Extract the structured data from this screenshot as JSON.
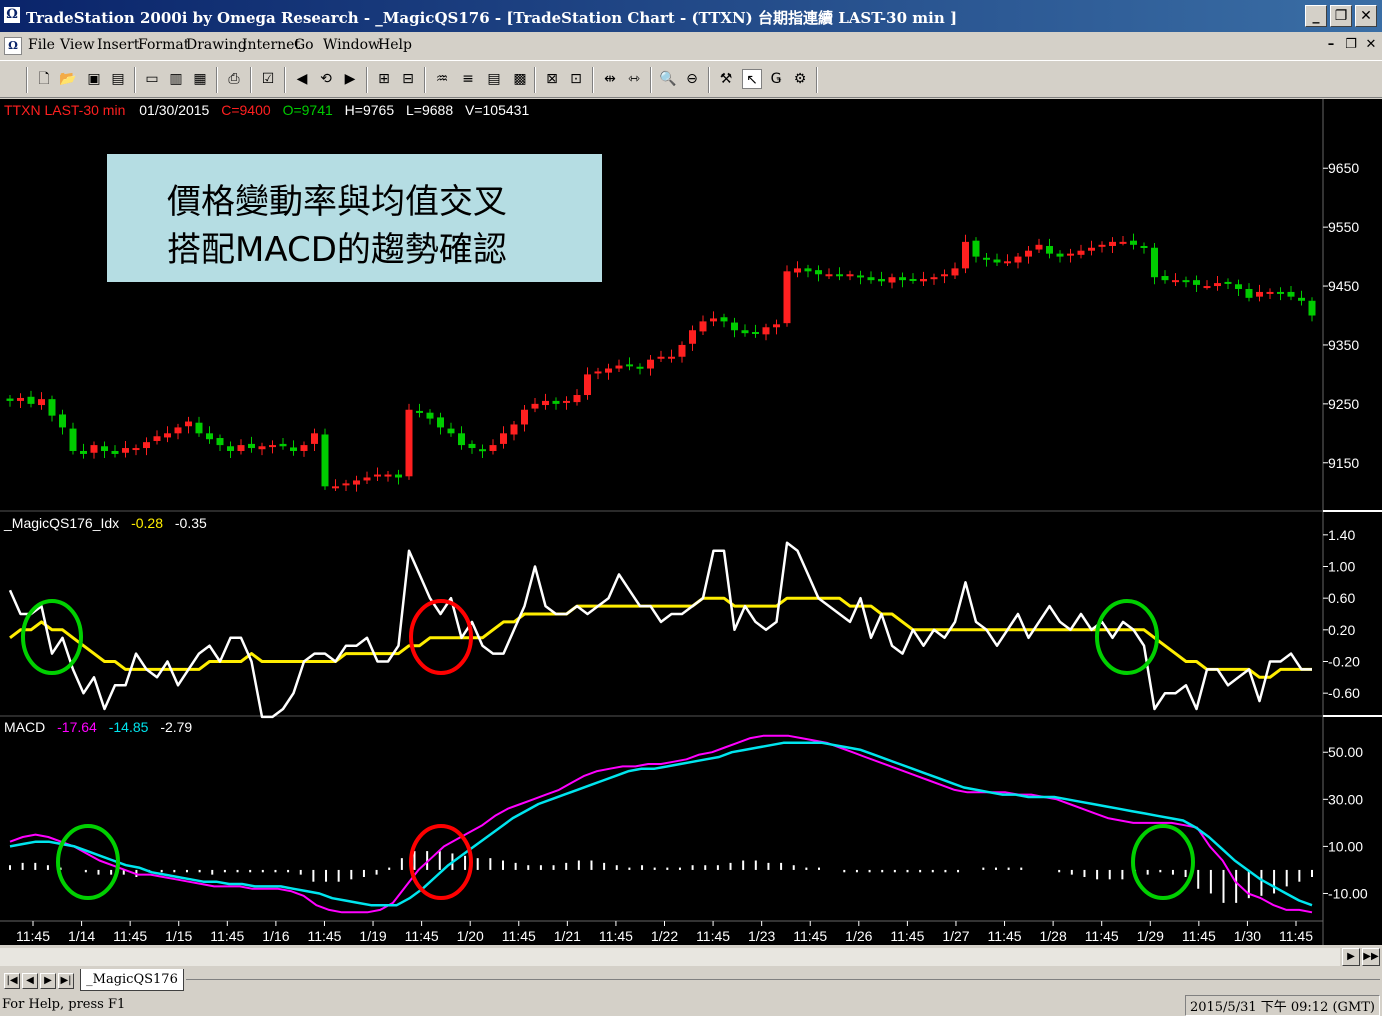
{
  "window": {
    "title": "TradeStation 2000i by Omega Research - _MagicQS176 - [TradeStation Chart - (TTXN) 台期指連續 LAST-30 min ]",
    "app_icon": "omega-icon"
  },
  "menu": {
    "items": [
      "File",
      "View",
      "Insert",
      "Format",
      "Drawing",
      "Internet",
      "Go",
      "Window",
      "Help"
    ]
  },
  "toolbar": {
    "icons": [
      "new-icon",
      "open-icon",
      "save-all-icon",
      "open-folder-icon",
      "window-icon",
      "chart-icon",
      "grid-icon",
      "print-icon",
      "properties-icon",
      "back-icon",
      "refresh-icon",
      "forward-icon",
      "insert-indicator-icon",
      "insert-study-icon",
      "analysis-icon",
      "format-icon",
      "table-icon",
      "activity-icon",
      "tile-icon",
      "space-in-icon",
      "space-out-icon",
      "zoom-in-icon",
      "zoom-out-icon",
      "hammer-icon",
      "pointer-icon",
      "gap-icon",
      "magnet-icon"
    ]
  },
  "chart": {
    "price_header": {
      "symbol": "TTXN LAST-30 min",
      "date": "01/30/2015",
      "close": "C=9400",
      "open": "O=9741",
      "high": "H=9765",
      "low": "L=9688",
      "volume": "V=105431"
    },
    "annotation": {
      "line1": "價格變動率與均值交叉",
      "line2": "搭配MACD的趨勢確認"
    },
    "idx_header": {
      "name": "_MagicQS176_Idx",
      "value1": "-0.28",
      "value2": "-0.35"
    },
    "macd_header": {
      "name": "MACD",
      "value1": "-17.64",
      "value2": "-14.85",
      "value3": "-2.79"
    },
    "price_axis": [
      "9650",
      "9550",
      "9450",
      "9350",
      "9250",
      "9150"
    ],
    "idx_axis": [
      "1.40",
      "1.00",
      "0.60",
      "0.20",
      "-0.20",
      "-0.60"
    ],
    "macd_axis": [
      "50.00",
      "30.00",
      "10.00",
      "-10.00"
    ],
    "time_axis": [
      "11:45",
      "1/14",
      "11:45",
      "1/15",
      "11:45",
      "1/16",
      "11:45",
      "1/19",
      "11:45",
      "1/20",
      "11:45",
      "1/21",
      "11:45",
      "1/22",
      "11:45",
      "1/23",
      "11:45",
      "1/26",
      "11:45",
      "1/27",
      "11:45",
      "1/28",
      "11:45",
      "1/29",
      "11:45",
      "1/30",
      "11:45"
    ],
    "colors": {
      "up": "#ff2020",
      "down": "#00cc00",
      "idx_line": "#ffffff",
      "idx_avg": "#ffee00",
      "macd": "#ff00ff",
      "signal": "#00e5ee",
      "hist": "#ffffff",
      "circle_green": "#00d000",
      "circle_red": "#ff0000",
      "header_red": "#ff2020",
      "header_green": "#00cc00",
      "header_yellow": "#ffee00",
      "header_magenta": "#ff00ff",
      "header_cyan": "#00e5ee"
    }
  },
  "chart_data": [
    {
      "type": "candlestick",
      "title": "TTXN LAST-30 min",
      "ylim": [
        9080,
        9720
      ],
      "yticks": [
        9650,
        9550,
        9450,
        9350,
        9250,
        9150
      ],
      "close_path": [
        9255,
        9260,
        9250,
        9258,
        9230,
        9210,
        9170,
        9165,
        9180,
        9170,
        9165,
        9175,
        9175,
        9185,
        9195,
        9200,
        9210,
        9220,
        9200,
        9190,
        9180,
        9170,
        9180,
        9175,
        9178,
        9180,
        9178,
        9170,
        9180,
        9200,
        9110,
        9110,
        9115,
        9120,
        9125,
        9130,
        9130,
        9125,
        9240,
        9235,
        9225,
        9210,
        9200,
        9180,
        9175,
        9170,
        9180,
        9200,
        9215,
        9240,
        9250,
        9255,
        9250,
        9255,
        9265,
        9300,
        9305,
        9310,
        9315,
        9315,
        9310,
        9325,
        9330,
        9330,
        9350,
        9375,
        9390,
        9395,
        9390,
        9375,
        9370,
        9370,
        9380,
        9385,
        9475,
        9480,
        9475,
        9470,
        9470,
        9468,
        9470,
        9465,
        9460,
        9458,
        9465,
        9460,
        9460,
        9462,
        9465,
        9470,
        9480,
        9525,
        9500,
        9495,
        9490,
        9492,
        9500,
        9510,
        9520,
        9505,
        9500,
        9505,
        9510,
        9515,
        9520,
        9525,
        9525,
        9520,
        9515,
        9465,
        9460,
        9460,
        9458,
        9452,
        9450,
        9455,
        9455,
        9445,
        9430,
        9440,
        9440,
        9438,
        9432,
        9425,
        9400
      ],
      "data_note": "Values read from the price panel; green candles are down bars and red candles are up bars."
    },
    {
      "type": "line",
      "title": "_MagicQS176_Idx",
      "ylim": [
        -0.8,
        1.6
      ],
      "yticks": [
        1.4,
        1.0,
        0.6,
        0.2,
        -0.2,
        -0.6
      ],
      "series": [
        {
          "name": "_MagicQS176_Idx",
          "values": [
            0.7,
            0.4,
            0.4,
            0.5,
            -0.1,
            0.1,
            -0.3,
            -0.6,
            -0.4,
            -0.8,
            -0.5,
            -0.5,
            -0.1,
            -0.3,
            -0.4,
            -0.2,
            -0.5,
            -0.3,
            -0.1,
            0.0,
            -0.2,
            0.1,
            0.1,
            -0.2,
            -0.9,
            -0.9,
            -0.8,
            -0.6,
            -0.2,
            -0.1,
            -0.1,
            -0.2,
            0.0,
            0.0,
            0.1,
            -0.2,
            -0.2,
            0.0,
            1.2,
            0.9,
            0.6,
            0.4,
            0.6,
            0.1,
            0.3,
            0.0,
            -0.1,
            -0.1,
            0.2,
            0.5,
            1.0,
            0.5,
            0.4,
            0.4,
            0.5,
            0.4,
            0.5,
            0.6,
            0.9,
            0.7,
            0.5,
            0.5,
            0.3,
            0.4,
            0.4,
            0.5,
            0.6,
            1.2,
            1.2,
            0.2,
            0.5,
            0.3,
            0.2,
            0.3,
            1.3,
            1.2,
            0.9,
            0.6,
            0.5,
            0.4,
            0.3,
            0.6,
            0.1,
            0.4,
            0.0,
            -0.1,
            0.2,
            0.0,
            0.2,
            0.1,
            0.3,
            0.8,
            0.3,
            0.2,
            0.0,
            0.2,
            0.4,
            0.1,
            0.3,
            0.5,
            0.3,
            0.2,
            0.4,
            0.2,
            0.3,
            0.1,
            0.3,
            0.2,
            0.0,
            -0.8,
            -0.6,
            -0.6,
            -0.5,
            -0.8,
            -0.3,
            -0.3,
            -0.5,
            -0.4,
            -0.3,
            -0.7,
            -0.2,
            -0.2,
            -0.1,
            -0.3,
            -0.3
          ]
        },
        {
          "name": "Average",
          "values": [
            0.1,
            0.2,
            0.2,
            0.3,
            0.2,
            0.2,
            0.1,
            0.0,
            -0.1,
            -0.2,
            -0.2,
            -0.3,
            -0.3,
            -0.3,
            -0.3,
            -0.3,
            -0.3,
            -0.3,
            -0.3,
            -0.2,
            -0.2,
            -0.2,
            -0.2,
            -0.1,
            -0.2,
            -0.2,
            -0.2,
            -0.2,
            -0.2,
            -0.2,
            -0.2,
            -0.2,
            -0.1,
            -0.1,
            -0.1,
            -0.1,
            -0.1,
            -0.1,
            0.0,
            0.0,
            0.1,
            0.1,
            0.1,
            0.1,
            0.1,
            0.1,
            0.2,
            0.3,
            0.3,
            0.4,
            0.4,
            0.4,
            0.4,
            0.4,
            0.5,
            0.5,
            0.5,
            0.5,
            0.5,
            0.5,
            0.5,
            0.5,
            0.5,
            0.5,
            0.5,
            0.5,
            0.6,
            0.6,
            0.6,
            0.5,
            0.5,
            0.5,
            0.5,
            0.5,
            0.6,
            0.6,
            0.6,
            0.6,
            0.6,
            0.6,
            0.5,
            0.5,
            0.5,
            0.4,
            0.4,
            0.3,
            0.2,
            0.2,
            0.2,
            0.2,
            0.2,
            0.2,
            0.2,
            0.2,
            0.2,
            0.2,
            0.2,
            0.2,
            0.2,
            0.2,
            0.2,
            0.2,
            0.2,
            0.2,
            0.2,
            0.2,
            0.2,
            0.2,
            0.2,
            0.1,
            0.0,
            -0.1,
            -0.2,
            -0.2,
            -0.3,
            -0.3,
            -0.3,
            -0.3,
            -0.3,
            -0.4,
            -0.4,
            -0.3,
            -0.3,
            -0.3,
            -0.3
          ]
        }
      ]
    },
    {
      "type": "line",
      "title": "MACD",
      "ylim": [
        -20,
        62
      ],
      "yticks": [
        50,
        30,
        10,
        -10
      ],
      "series": [
        {
          "name": "MACD",
          "values": [
            12,
            14,
            15,
            14,
            12,
            10,
            7,
            4,
            2,
            0,
            -2,
            -2,
            -3,
            -4,
            -5,
            -6,
            -7,
            -7,
            -7,
            -8,
            -8,
            -8,
            -9,
            -11,
            -15,
            -17,
            -18,
            -18,
            -18,
            -17,
            -14,
            -7,
            0,
            5,
            10,
            13,
            16,
            19,
            23,
            26,
            28,
            30,
            32,
            34,
            37,
            40,
            42,
            43,
            44,
            44,
            45,
            45,
            46,
            47,
            49,
            50,
            52,
            54,
            56,
            57,
            57,
            57,
            56,
            55,
            54,
            52,
            50,
            48,
            46,
            44,
            42,
            40,
            38,
            36,
            34,
            33,
            33,
            33,
            33,
            32,
            32,
            31,
            30,
            28,
            26,
            24,
            22,
            21,
            20,
            20,
            20,
            20,
            19,
            18,
            10,
            4,
            -5,
            -10,
            -12,
            -15,
            -17,
            -17,
            -18
          ]
        },
        {
          "name": "Signal",
          "values": [
            10,
            11,
            12,
            12,
            11,
            10,
            8,
            6,
            4,
            2,
            1,
            -1,
            -2,
            -3,
            -4,
            -5,
            -5,
            -6,
            -6,
            -7,
            -7,
            -7,
            -8,
            -9,
            -10,
            -12,
            -13,
            -14,
            -15,
            -15,
            -15,
            -12,
            -8,
            -3,
            2,
            6,
            10,
            14,
            18,
            22,
            25,
            28,
            30,
            32,
            34,
            36,
            38,
            40,
            42,
            43,
            43,
            44,
            45,
            46,
            47,
            48,
            50,
            51,
            52,
            53,
            54,
            54,
            54,
            54,
            53,
            52,
            51,
            49,
            47,
            45,
            43,
            41,
            39,
            37,
            35,
            34,
            33,
            32,
            32,
            31,
            31,
            31,
            30,
            29,
            28,
            27,
            26,
            25,
            24,
            23,
            22,
            21,
            18,
            14,
            9,
            4,
            0,
            -4,
            -7,
            -10,
            -13,
            -15
          ]
        },
        {
          "name": "Hist",
          "values": [
            2,
            3,
            3,
            2,
            1,
            0,
            -1,
            -2,
            -2,
            -2,
            -3,
            -1,
            -1,
            -1,
            -1,
            -1,
            -2,
            -1,
            -1,
            -1,
            -1,
            -1,
            -1,
            -2,
            -5,
            -5,
            -5,
            -4,
            -3,
            -2,
            1,
            5,
            8,
            8,
            8,
            7,
            6,
            5,
            5,
            4,
            3,
            2,
            2,
            2,
            3,
            4,
            4,
            3,
            2,
            1,
            2,
            1,
            1,
            1,
            2,
            2,
            2,
            3,
            4,
            4,
            3,
            3,
            2,
            1,
            1,
            0,
            -1,
            -1,
            -1,
            -1,
            -1,
            -1,
            -1,
            -1,
            -1,
            -1,
            0,
            1,
            1,
            1,
            1,
            0,
            0,
            -1,
            -2,
            -3,
            -4,
            -4,
            -4,
            -3,
            -2,
            -1,
            -2,
            -3,
            -8,
            -10,
            -14,
            -14,
            -12,
            -11,
            -10,
            -7,
            -5,
            -3
          ]
        }
      ]
    }
  ],
  "tabs": {
    "active": "_MagicQS176"
  },
  "status": {
    "left": "For Help, press F1",
    "right": "2015/5/31 下午 09:12 (GMT)"
  }
}
